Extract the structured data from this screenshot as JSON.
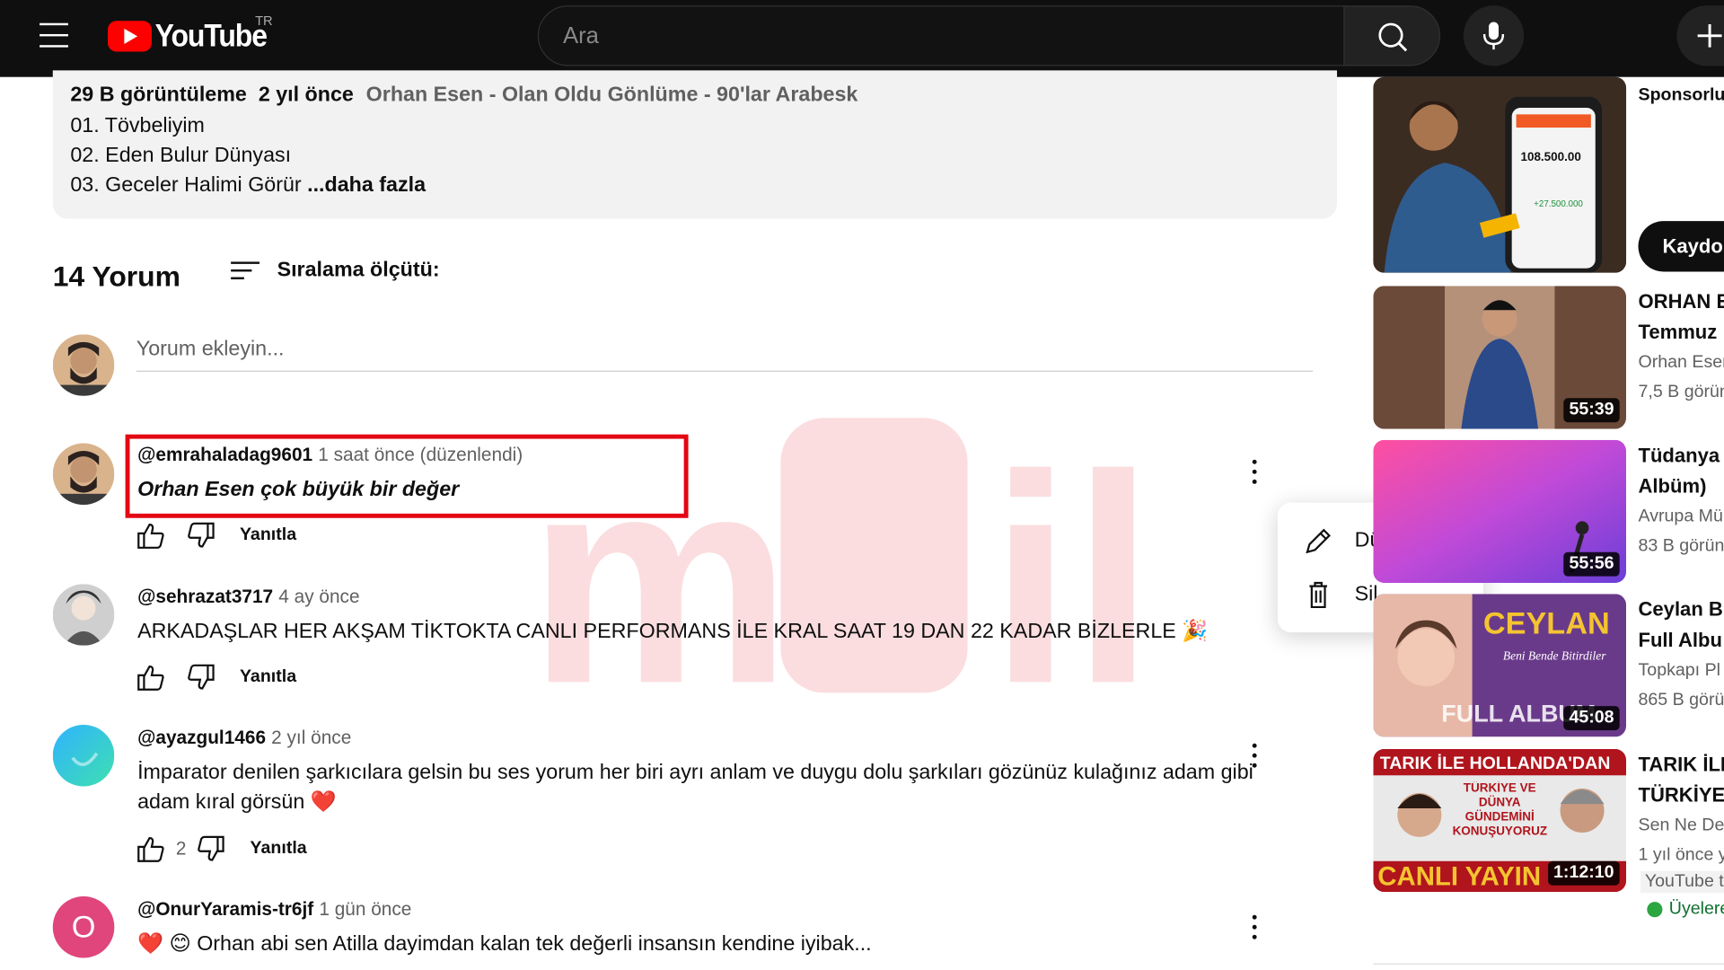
{
  "header": {
    "logo_text": "YouTube",
    "country": "TR",
    "search_placeholder": "Ara"
  },
  "description": {
    "views": "29 B görüntüleme",
    "age": "2 yıl önce",
    "title": "Orhan Esen - Olan Oldu Gönlüme - 90'lar Arabesk",
    "lines": [
      "01. Tövbeliyim",
      "02. Eden Bulur Dünyası",
      "03. Geceler Halimi Görür"
    ],
    "more": "...daha fazla"
  },
  "comments_header": {
    "count": "14 Yorum",
    "sort_label": "Sıralama ölçütü:"
  },
  "add_comment": {
    "placeholder": "Yorum ekleyin..."
  },
  "comments": [
    {
      "user": "@emrahaladag9601",
      "time": "1 saat önce (düzenlendi)",
      "text": "Orhan Esen çok büyük bir değer",
      "likes": "",
      "reply": "Yanıtla"
    },
    {
      "user": "@sehrazat3717",
      "time": "4 ay önce",
      "text": "ARKADAŞLAR HER AKŞAM TİKTOKTA CANLI PERFORMANS İLE KRAL SAAT 19 DAN 22 KADAR BİZLERLE 🎉",
      "likes": "",
      "reply": "Yanıtla"
    },
    {
      "user": "@ayazgul1466",
      "time": "2 yıl önce",
      "text": "İmparator denilen şarkıcılara gelsin bu ses yorum  her biri ayrı anlam ve duygu dolu şarkıları  gözünüz kulağınız adam gibi adam kıral görsün ❤️",
      "likes": "2",
      "reply": "Yanıtla"
    },
    {
      "user": "@OnurYaramis-tr6jf",
      "time": "1 gün önce",
      "text": "❤️ 😊 Orhan abi sen Atilla dayimdan kalan tek değerli insansın  kendine iyibak...",
      "likes": "",
      "reply": "Yanıtla",
      "avatar_letter": "O"
    }
  ],
  "context_menu": {
    "edit": "Düzenle",
    "delete": "Sil"
  },
  "sidebar": {
    "sponsor_label": "Sponsorlu",
    "signup_button": "Kaydol",
    "ad_amount_1": "108.500.00",
    "ad_amount_2": "+27.500.000",
    "videos": [
      {
        "title_1": "ORHAN E",
        "title_2": "Temmuz",
        "channel": "Orhan Esen",
        "meta": "7,5 B görün",
        "duration": "55:39"
      },
      {
        "title_1": "Tüdanya",
        "title_2": "Albüm)",
        "channel": "Avrupa Mü",
        "meta": "83 B görün",
        "duration": "55:56"
      },
      {
        "title_1": "Ceylan B",
        "title_2": "Full Albu",
        "channel": "Topkapı Pl",
        "meta": "865 B görü",
        "duration": "45:08",
        "thumb_brand": "CEYLAN",
        "thumb_sub": "Beni Bende Bitirdiler",
        "thumb_full": "FULL ALBUM"
      },
      {
        "title_1": "TARIK İLE",
        "title_2": "TÜRKİYE",
        "channel": "Sen Ne De",
        "meta": "1 yıl önce y",
        "duration": "1:12:10",
        "thumb_top": "TARIK İLE HOLLANDA'DAN",
        "thumb_mid": "TÜRKİYE VE DÜNYA GÜNDEMİNİ KONUŞUYORUZ!",
        "thumb_live": "CANLI YAYIN"
      }
    ],
    "youtube_badge": "YouTube t",
    "members_label": "Üyelere"
  },
  "colors": {
    "accent_red": "#ff0000",
    "highlight": "#e30613",
    "topbar": "#0f0f0f"
  }
}
